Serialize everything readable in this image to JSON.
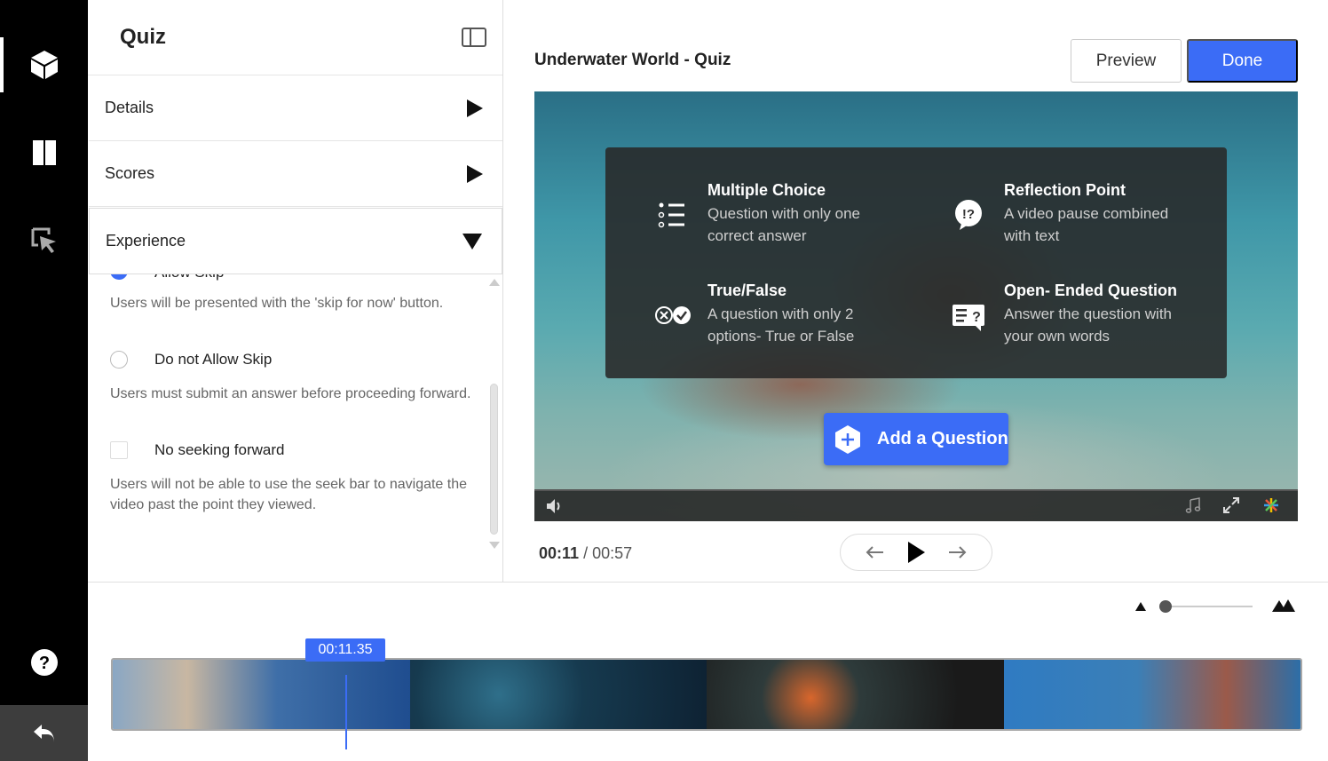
{
  "rail": {
    "items": [
      "cube-icon",
      "split-icon",
      "cursor-icon"
    ],
    "help": "?",
    "back": "undo-icon"
  },
  "panel": {
    "title": "Quiz",
    "sections": [
      {
        "label": "Details",
        "expanded": false
      },
      {
        "label": "Scores",
        "expanded": false
      },
      {
        "label": "Experience",
        "expanded": true
      }
    ],
    "experience": {
      "allow_skip_label": "Allow Skip",
      "allow_skip_desc": "Users will be presented with the 'skip for now' button.",
      "no_skip_label": "Do not Allow Skip",
      "no_skip_desc": "Users must submit an answer before proceeding forward.",
      "no_seek_label": "No seeking forward",
      "no_seek_desc": "Users will not be able to use the seek bar to navigate the video past the point they viewed."
    }
  },
  "main": {
    "title": "Underwater World - Quiz",
    "preview_label": "Preview",
    "done_label": "Done",
    "question_types": [
      {
        "title": "Multiple Choice",
        "desc": "Question with only one correct answer",
        "icon": "list-icon"
      },
      {
        "title": "Reflection Point",
        "desc": "A video pause combined with text",
        "icon": "reflection-icon"
      },
      {
        "title": "True/False",
        "desc": "A question with only 2 options- True or False",
        "icon": "true-false-icon"
      },
      {
        "title": "Open- Ended Question",
        "desc": "Answer the question with your own words",
        "icon": "open-ended-icon"
      }
    ],
    "add_question_label": "Add a Question",
    "time_current": "00:11",
    "time_sep": "/",
    "time_total": "00:57"
  },
  "timeline": {
    "playhead_time": "00:11.35"
  },
  "colors": {
    "accent": "#3b6cf6",
    "rail": "#000000"
  }
}
